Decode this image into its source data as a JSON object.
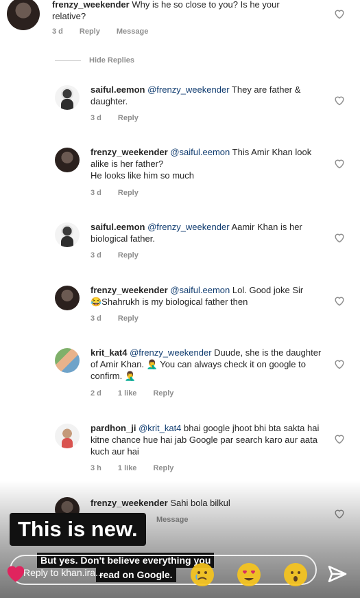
{
  "comments": [
    {
      "username": "frenzy_weekender",
      "mention": "",
      "text": "Why is he so close to you? Is he your relative?",
      "meta": [
        "3 d",
        "Reply",
        "Message"
      ]
    },
    {
      "hide_replies": "Hide Replies"
    },
    {
      "username": "saiful.eemon",
      "mention": "@frenzy_weekender",
      "text": "They are father & daughter.",
      "meta": [
        "3 d",
        "Reply"
      ]
    },
    {
      "username": "frenzy_weekender",
      "mention": "@saiful.eemon",
      "text": "This Amir Khan look alike is her father?",
      "text2": "He looks like him so much",
      "meta": [
        "3 d",
        "Reply"
      ]
    },
    {
      "username": "saiful.eemon",
      "mention": "@frenzy_weekender",
      "text": "Aamir Khan is her biological father.",
      "meta": [
        "3 d",
        "Reply"
      ]
    },
    {
      "username": "frenzy_weekender",
      "mention": "@saiful.eemon",
      "text": "Lol. Good joke Sir",
      "text2": "😂Shahrukh is my biological father then",
      "meta": [
        "3 d",
        "Reply"
      ]
    },
    {
      "username": "krit_kat4",
      "mention": "@frenzy_weekender",
      "text": "Duude, she is the daughter of Amir Khan. 🤦‍♂️ You can always check it on google to confirm. 🤦‍♂️",
      "meta": [
        "2 d",
        "1 like",
        "Reply"
      ]
    },
    {
      "username": "pardhon_ji",
      "mention": "@krit_kat4",
      "text": "bhai google jhoot bhi bta sakta hai kitne chance hue hai jab Google par search karo aur aata kuch aur hai",
      "meta": [
        "3 h",
        "1 like",
        "Reply"
      ]
    },
    {
      "username": "frenzy_weekender",
      "mention": "",
      "text": "Sahi bola bilkul",
      "meta": [
        "Message"
      ]
    }
  ],
  "story": {
    "banner": "This is new.",
    "caption_line1": "But yes. Don't believe everything you",
    "caption_line2": "read on Google.",
    "reply_placeholder": "Reply to khan.ira..."
  },
  "icons": {
    "like": "heart-outline-icon",
    "reaction_heart": "red-heart-icon",
    "send": "send-icon",
    "emojis": [
      "crying-emoji-icon",
      "heart-eyes-emoji-icon",
      "surprised-emoji-icon"
    ]
  },
  "colors": {
    "text": "#262626",
    "muted": "#8e8e8e",
    "mention": "#0f3b6f",
    "overlay": "#111111",
    "heart_red": "#e0245e"
  }
}
